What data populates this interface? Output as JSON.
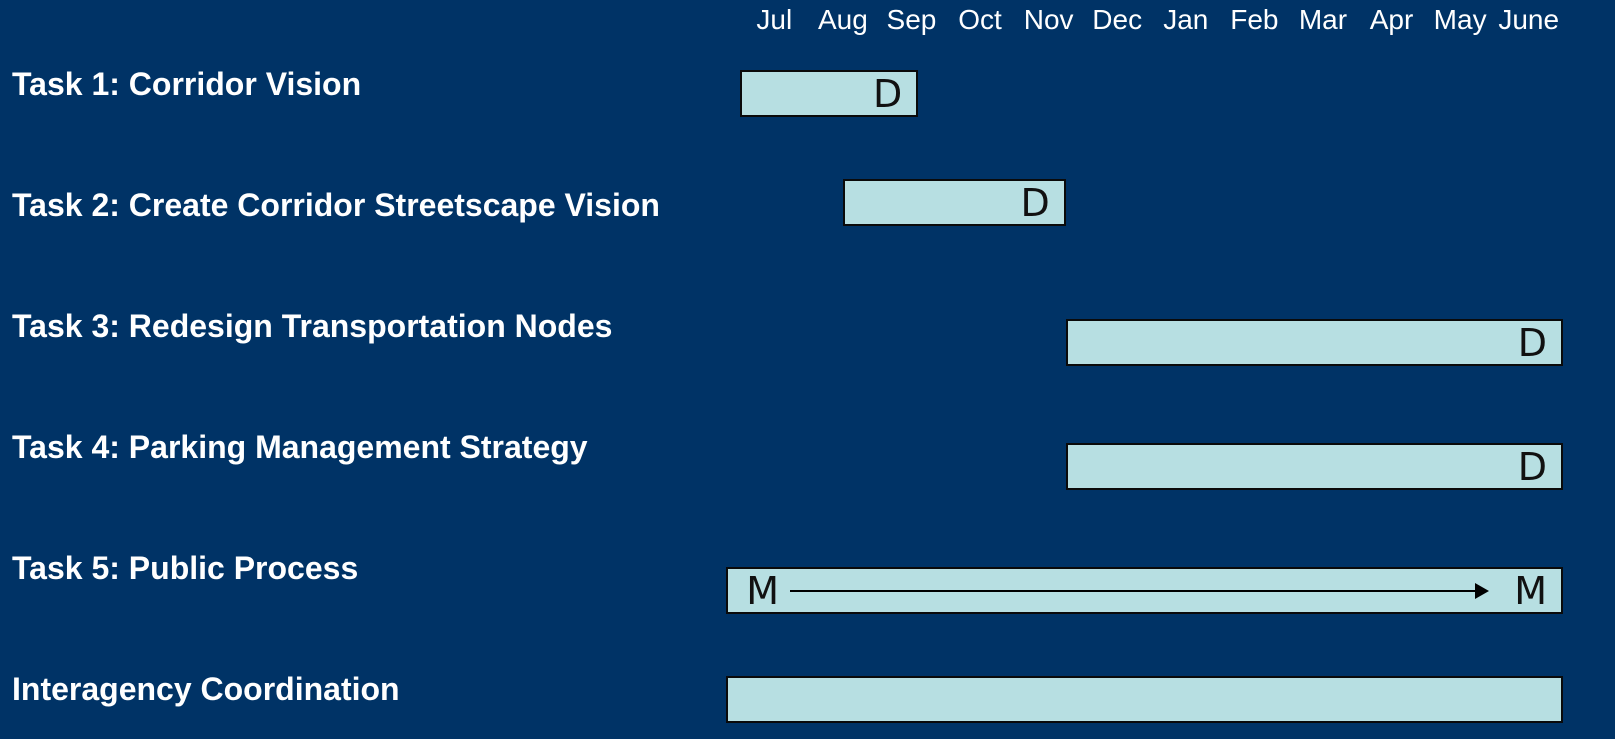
{
  "chart_data": {
    "type": "gantt",
    "months": [
      "Jul",
      "Aug",
      "Sep",
      "Oct",
      "Nov",
      "Dec",
      "Jan",
      "Feb",
      "Mar",
      "Apr",
      "May",
      "June"
    ],
    "tasks": [
      {
        "label": "Task 1: Corridor Vision",
        "start": 0.0,
        "end": 2.6,
        "markers": [
          {
            "text": "D",
            "at": "end"
          }
        ]
      },
      {
        "label": "Task 2: Create Corridor Streetscape Vision",
        "start": 1.5,
        "end": 4.75,
        "markers": [
          {
            "text": "D",
            "at": "end"
          }
        ]
      },
      {
        "label": "Task 3: Redesign Transportation Nodes",
        "start": 4.75,
        "end": 12.0,
        "markers": [
          {
            "text": "D",
            "at": "end"
          }
        ]
      },
      {
        "label": "Task 4: Parking Management Strategy",
        "start": 4.75,
        "end": 12.0,
        "markers": [
          {
            "text": "D",
            "at": "end"
          }
        ]
      },
      {
        "label": "Task 5: Public Process",
        "start": -0.2,
        "end": 12.0,
        "markers": [
          {
            "text": "M",
            "at": "start"
          },
          {
            "text": "M",
            "at": "end"
          }
        ],
        "arrow": true
      },
      {
        "label": "Interagency Coordination",
        "start": -0.2,
        "end": 12.0,
        "markers": []
      }
    ],
    "colors": {
      "background": "#003366",
      "bar": "#b7dfe2",
      "bar_border": "#0a0a0a",
      "text": "#ffffff",
      "marker": "#111111"
    }
  }
}
